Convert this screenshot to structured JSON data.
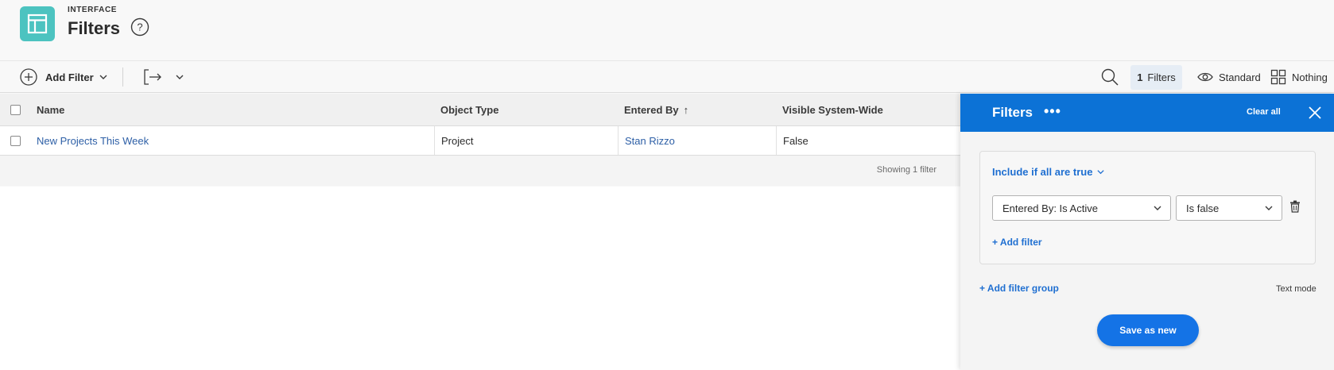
{
  "header": {
    "overline": "INTERFACE",
    "title": "Filters",
    "help_glyph": "?"
  },
  "toolbar": {
    "add_filter_label": "Add Filter",
    "filters_count": "1",
    "filters_label": "Filters",
    "view_label": "Standard",
    "grouping_label": "Nothing"
  },
  "table": {
    "columns": [
      "Name",
      "Object Type",
      "Entered By",
      "Visible System-Wide"
    ],
    "sort_indicator": "↑",
    "rows": [
      {
        "name": "New Projects This Week",
        "object_type": "Project",
        "entered_by": "Stan Rizzo",
        "visible": "False"
      }
    ],
    "summary": "Showing 1 filter"
  },
  "panel": {
    "title": "Filters",
    "more_glyph": "•••",
    "clear_all": "Clear all",
    "group_rule": "Include if all are true",
    "filter_field": "Entered By: Is Active",
    "filter_operator": "Is false",
    "add_filter": "+ Add filter",
    "add_group": "+ Add filter group",
    "text_mode": "Text mode",
    "save_button": "Save as new"
  },
  "colors": {
    "accent": "#0c72d6",
    "primary_button": "#1473e6",
    "link": "#2d5fa6",
    "app_icon": "#4cc3c0"
  },
  "icons": [
    "layout-icon",
    "help-icon",
    "add-circle-icon",
    "chevron-down-icon",
    "export-icon",
    "search-icon",
    "eye-icon",
    "grid-icon",
    "more-icon",
    "close-icon",
    "trash-icon"
  ]
}
